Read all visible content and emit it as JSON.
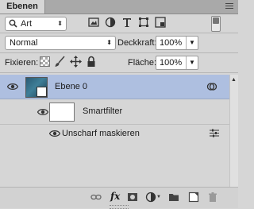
{
  "panel": {
    "tab_label": "Ebenen",
    "filter_kind": "Art",
    "blend_mode": "Normal",
    "opacity_label": "Deckkraft:",
    "opacity_value": "100%",
    "lock_label": "Fixieren:",
    "fill_label": "Fläche:",
    "fill_value": "100%"
  },
  "layers": [
    {
      "name": "Ebene 0",
      "selected": true,
      "smart_object": true
    },
    {
      "name": "Smartfilter"
    },
    {
      "name": "Unscharf maskieren"
    }
  ],
  "footer_icons": [
    "link-icon",
    "fx-icon",
    "mask-icon",
    "adjustment-icon",
    "folder-icon",
    "new-layer-icon",
    "trash-icon"
  ]
}
